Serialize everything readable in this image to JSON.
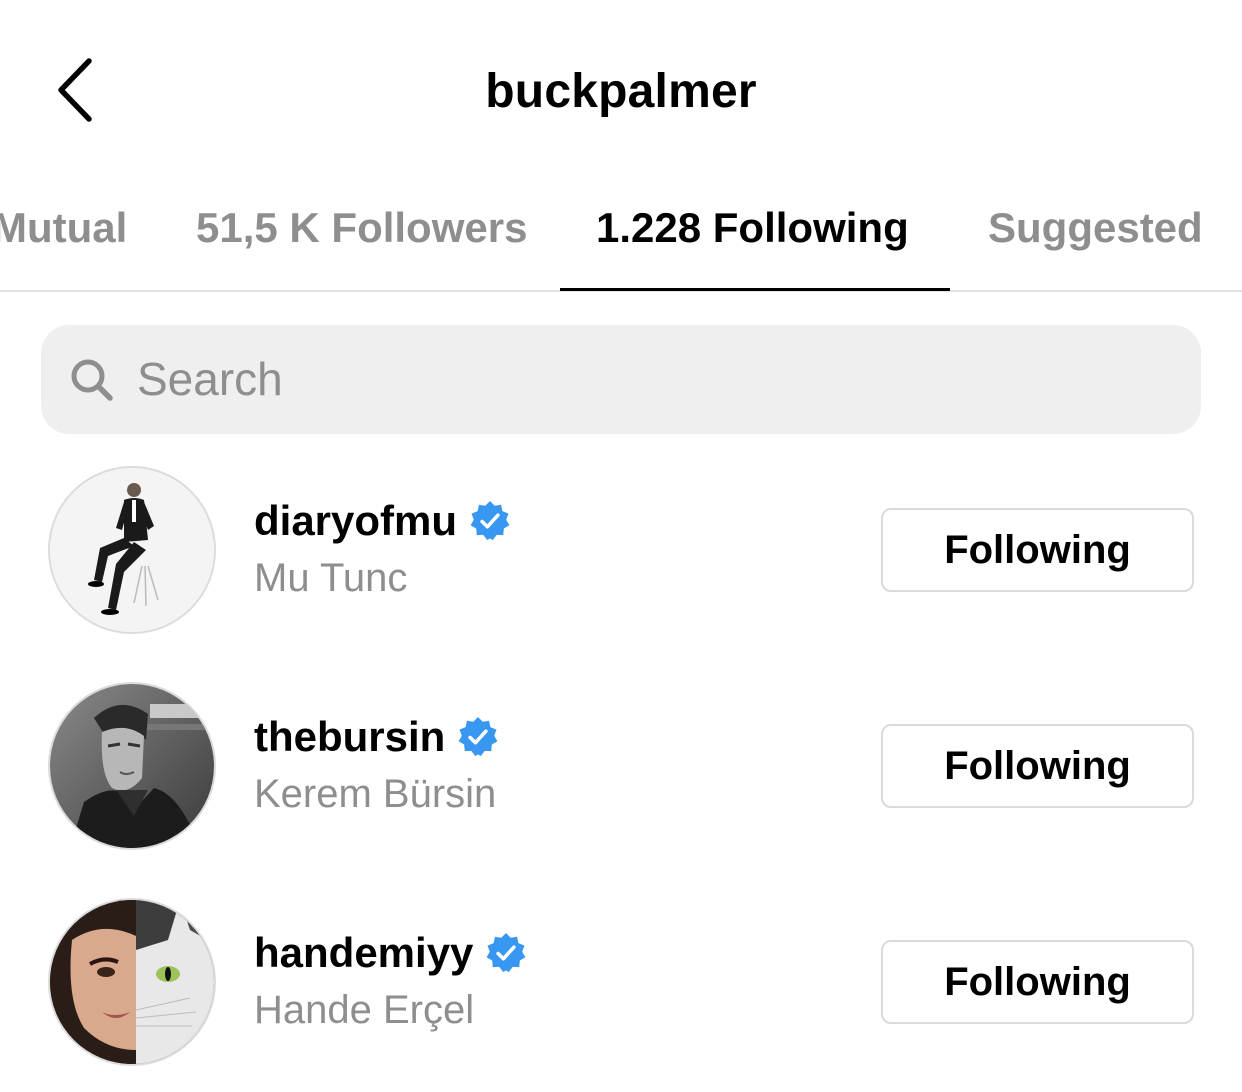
{
  "header": {
    "back_icon": "chevron-left-icon",
    "title": "buckpalmer"
  },
  "tabs": [
    {
      "label": "Mutual",
      "active": false
    },
    {
      "label": "51,5 K Followers",
      "active": false
    },
    {
      "label": "1.228 Following",
      "active": true
    },
    {
      "label": "Suggested",
      "active": false
    }
  ],
  "search": {
    "icon": "search-icon",
    "placeholder": "Search",
    "value": ""
  },
  "users": [
    {
      "username": "diaryofmu",
      "full_name": "Mu Tunc",
      "verified": true,
      "button_label": "Following",
      "avatar": "man-in-suit-on-chair-photo"
    },
    {
      "username": "thebursin",
      "full_name": "Kerem Bürsin",
      "verified": true,
      "button_label": "Following",
      "avatar": "man-portrait-photo"
    },
    {
      "username": "handemiyy",
      "full_name": "Hande Erçel",
      "verified": true,
      "button_label": "Following",
      "avatar": "woman-and-cat-photo"
    }
  ],
  "colors": {
    "verified_blue": "#3897f0",
    "secondary_text": "#8e8e8e",
    "search_bg": "#efefef",
    "border": "#dbdbdb"
  }
}
